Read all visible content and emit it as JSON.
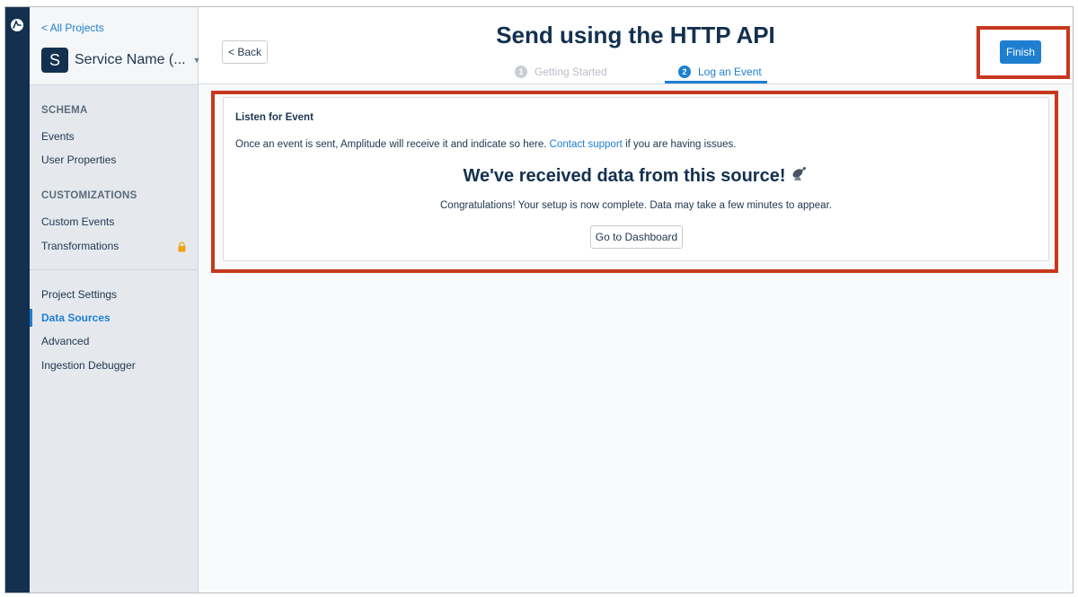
{
  "sidebar": {
    "all_projects": "< All Projects",
    "project": {
      "avatar_letter": "S",
      "name": "Service Name (..."
    },
    "sections": [
      {
        "title": "SCHEMA",
        "items": [
          "Events",
          "User Properties"
        ]
      },
      {
        "title": "CUSTOMIZATIONS",
        "items": [
          "Custom Events",
          "Transformations"
        ]
      }
    ],
    "settings_items": [
      "Project Settings",
      "Data Sources",
      "Advanced",
      "Ingestion Debugger"
    ],
    "active_item": "Data Sources"
  },
  "header": {
    "back_label": "< Back",
    "title": "Send using the HTTP API",
    "steps": [
      {
        "number": "1",
        "label": "Getting Started",
        "state": "inactive"
      },
      {
        "number": "2",
        "label": "Log an Event",
        "state": "active"
      }
    ],
    "finish_label": "Finish"
  },
  "card": {
    "title": "Listen for Event",
    "desc_before": "Once an event is sent, Amplitude will receive it and indicate so here.",
    "contact_link": "Contact support",
    "desc_after": "if you are having issues.",
    "received_heading": "We've received data from this source!",
    "received_icon": "satellite-antenna-icon",
    "congrats": "Congratulations! Your setup is now complete. Data may take a few minutes to appear.",
    "dashboard_button": "Go to Dashboard"
  },
  "colors": {
    "accent": "#1e7fd1",
    "rail": "#13304f",
    "highlight": "#c8381e"
  }
}
